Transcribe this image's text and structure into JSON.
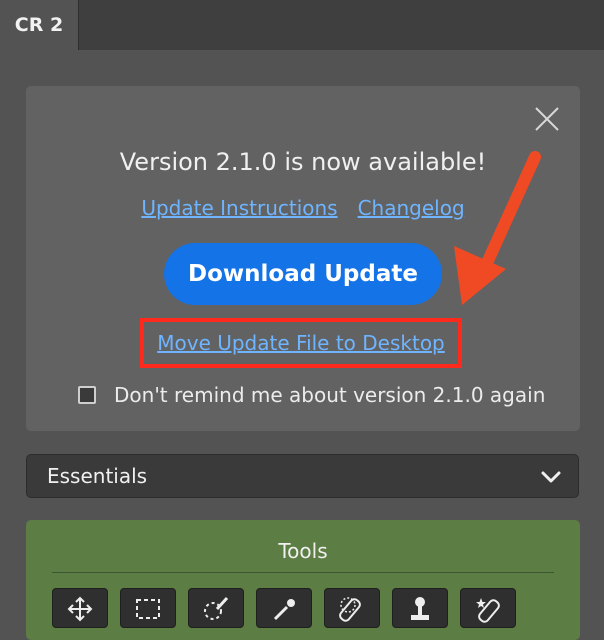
{
  "tab": {
    "label": "CR 2"
  },
  "update_panel": {
    "title": "Version 2.1.0 is now available!",
    "links": {
      "instructions": "Update Instructions",
      "changelog": "Changelog"
    },
    "download_button": "Download Update",
    "move_file_link": "Move Update File to Desktop",
    "remind_checkbox": {
      "label": "Don't remind me about version 2.1.0 again",
      "checked": false
    }
  },
  "workspace_dropdown": {
    "selected": "Essentials"
  },
  "tools_panel": {
    "title": "Tools",
    "tools": [
      {
        "icon": "move-icon"
      },
      {
        "icon": "marquee-icon"
      },
      {
        "icon": "quick-selection-icon"
      },
      {
        "icon": "eyedropper-icon"
      },
      {
        "icon": "spot-healing-icon"
      },
      {
        "icon": "clone-stamp-icon"
      },
      {
        "icon": "healing-brush-icon"
      }
    ]
  },
  "colors": {
    "accent_blue": "#1473e6",
    "link_blue": "#6fb4ff",
    "highlight_red": "#ff2a1c",
    "tools_green": "#5c7d43"
  }
}
